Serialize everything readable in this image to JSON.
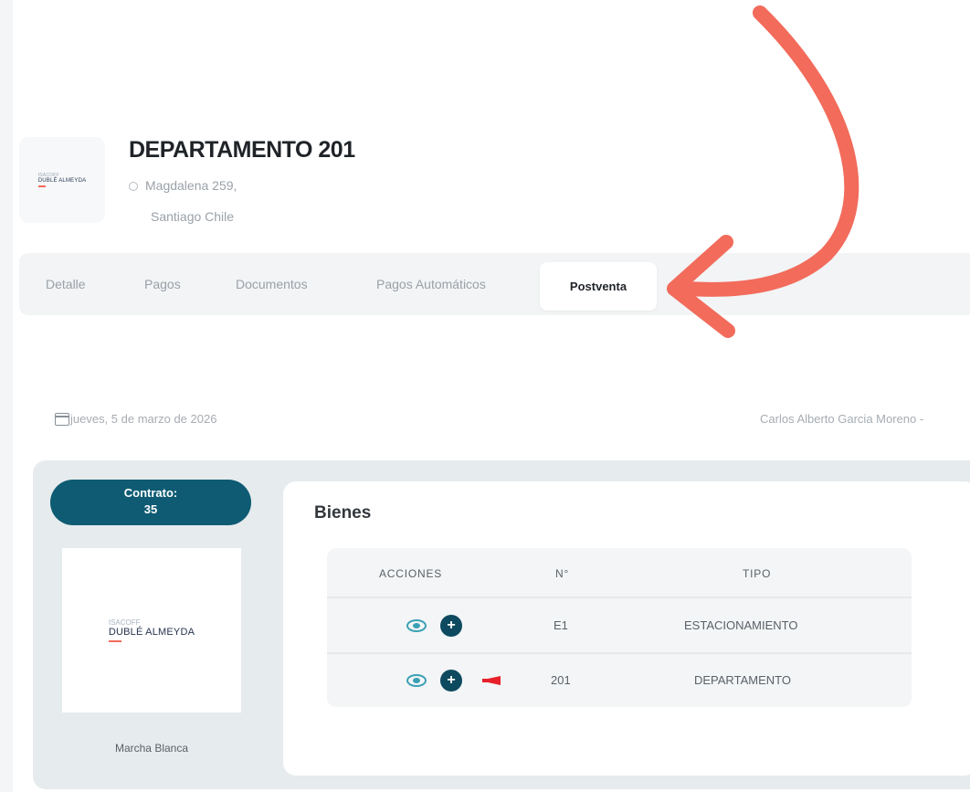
{
  "header": {
    "logo_top": "ISACOFF",
    "logo_name": "DUBLÉ ALMEYDA",
    "title": "DEPARTAMENTO 201",
    "address_line1": "Magdalena 259,",
    "address_line2": "Santiago Chile"
  },
  "tabs": [
    {
      "label": "Detalle"
    },
    {
      "label": "Pagos"
    },
    {
      "label": "Documentos"
    },
    {
      "label": "Pagos Automáticos"
    },
    {
      "label": "Postventa",
      "active": true
    }
  ],
  "info_row": {
    "date": "jueves, 5 de marzo de 2026",
    "user": "Carlos Alberto Garcia Moreno -"
  },
  "contract": {
    "label": "Contrato:",
    "number": "35",
    "image_logo_top": "ISACOFF",
    "image_logo_name": "DUBLÉ ALMEYDA",
    "caption": "Marcha Blanca"
  },
  "bienes": {
    "title": "Bienes",
    "columns": [
      "ACCIONES",
      "N°",
      "TIPO"
    ],
    "rows": [
      {
        "numero": "E1",
        "tipo": "ESTACIONAMIENTO",
        "alert": false
      },
      {
        "numero": "201",
        "tipo": "DEPARTAMENTO",
        "alert": true
      }
    ]
  },
  "colors": {
    "accent": "#0e5b73",
    "icon_teal": "#3aa0b4",
    "annotation_arrow": "#f26b5b",
    "alert_red": "#e8202a"
  },
  "icons": [
    "location-pin-icon",
    "calendar-icon",
    "eye-icon",
    "plus-circle-icon",
    "megaphone-icon",
    "annotation-arrow"
  ]
}
